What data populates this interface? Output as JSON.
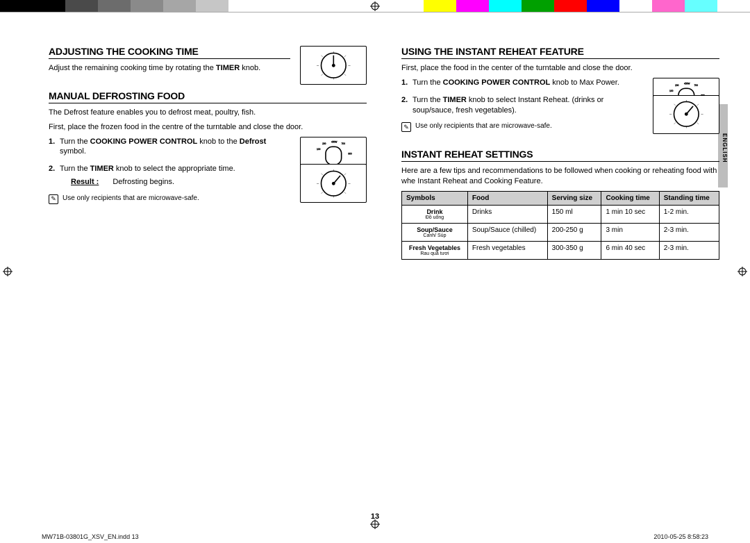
{
  "color_bar": [
    "#000000",
    "#000000",
    "#4a4a4a",
    "#6c6c6c",
    "#8a8a8a",
    "#a6a6a6",
    "#c6c6c6",
    "#ffffff",
    "#ffffff",
    "#ffffff",
    "#ffffff",
    "#ffffff",
    "#ffffff",
    "#ffff00",
    "#ff00ff",
    "#00ffff",
    "#00a000",
    "#ff0000",
    "#0000ff",
    "#ffffff",
    "#ff66cc",
    "#66ffff",
    "#ffffff"
  ],
  "lang_tab": "ENGLISH",
  "page_number": "13",
  "footer_left": "MW71B-03801G_XSV_EN.indd   13",
  "footer_right": "2010-05-25     8:58:23",
  "left": {
    "sec1": {
      "title": "Adjusting the cooking time",
      "body_a": "Adjust the remaining cooking time by rotating the ",
      "body_b": "TIMER",
      "body_c": " knob."
    },
    "sec2": {
      "title": "Manual Defrosting Food",
      "intro1": "The Defrost feature enables you to defrost meat, poultry, fish.",
      "intro2": "First, place the frozen food in the centre of the turntable and close the door.",
      "step1a": "Turn the ",
      "step1b": "COOKING POWER CONTROL",
      "step1c": " knob to the ",
      "step1d": "Defrost",
      "step1e": " symbol.",
      "step2a": "Turn the ",
      "step2b": "TIMER",
      "step2c": " knob to select the appropriate time.",
      "result_label": "Result :",
      "result_text": "Defrosting begins.",
      "note": "Use only recipients that are microwave-safe."
    }
  },
  "right": {
    "sec1": {
      "title": "Using the instant reheat feature",
      "intro": "First, place the food in the center of the turntable and close the door.",
      "step1a": "Turn the ",
      "step1b": "COOKING POWER CONTROL",
      "step1c": " knob to Max Power.",
      "step2a": "Turn the ",
      "step2b": "TIMER",
      "step2c": " knob to select Instant Reheat. (drinks or soup/sauce, fresh vegetables).",
      "note": "Use only recipients that are microwave-safe."
    },
    "sec2": {
      "title": "Instant reheat Settings",
      "intro": "Here are a few tips and recommendations to be followed when cooking or reheating food with whe Instant Reheat and Cooking Feature.",
      "headers": [
        "Symbols",
        "Food",
        "Serving size",
        "Cooking time",
        "Standing time"
      ],
      "rows": [
        {
          "sym1": "Drink",
          "sym2": "Đồ uống",
          "food": "Drinks",
          "serv": "150 ml",
          "cook": "1 min 10 sec",
          "stand": "1-2 min."
        },
        {
          "sym1": "Soup/Sauce",
          "sym2": "Canh/ Súp",
          "food": "Soup/Sauce (chilled)",
          "serv": "200-250 g",
          "cook": "3 min",
          "stand": "2-3 min."
        },
        {
          "sym1": "Fresh Vegetables",
          "sym2": "Rau quả tươi",
          "food": "Fresh vegetables",
          "serv": "300-350 g",
          "cook": "6 min 40 sec",
          "stand": "2-3 min."
        }
      ]
    }
  },
  "chart_data": {
    "type": "table",
    "title": "Instant Reheat Settings",
    "columns": [
      "Symbols",
      "Food",
      "Serving size",
      "Cooking time",
      "Standing time"
    ],
    "rows": [
      [
        "Drink / Đồ uống",
        "Drinks",
        "150 ml",
        "1 min 10 sec",
        "1-2 min."
      ],
      [
        "Soup/Sauce / Canh/ Súp",
        "Soup/Sauce (chilled)",
        "200-250 g",
        "3 min",
        "2-3 min."
      ],
      [
        "Fresh Vegetables / Rau quả tươi",
        "Fresh vegetables",
        "300-350 g",
        "6 min 40 sec",
        "2-3 min."
      ]
    ]
  }
}
